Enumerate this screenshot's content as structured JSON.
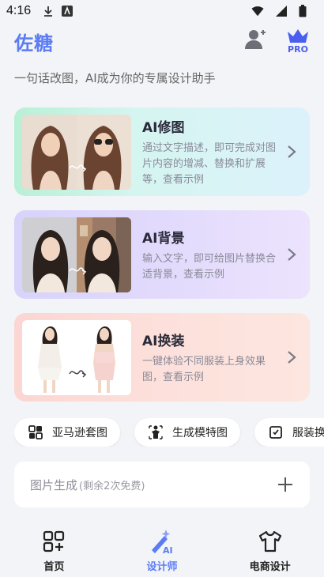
{
  "status_bar": {
    "time": "4:16"
  },
  "header": {
    "logo": "佐糖",
    "pro_label": "PRO"
  },
  "tagline": "一句话改图，AI成为你的专属设计助手",
  "cards": [
    {
      "title": "AI修图",
      "desc": "通过文字描述，即可完成对图片内容的增减、替换和扩展等，查看示例"
    },
    {
      "title": "AI背景",
      "desc": "输入文字，即可给图片替换合适背景，查看示例"
    },
    {
      "title": "AI换装",
      "desc": "一键体验不同服装上身效果图，查看示例"
    }
  ],
  "chips": [
    {
      "label": "亚马逊套图",
      "icon": "grid-layout-icon"
    },
    {
      "label": "生成模特图",
      "icon": "model-pose-icon"
    },
    {
      "label": "服装换",
      "icon": "clothing-tag-icon"
    }
  ],
  "generate": {
    "label": "图片生成",
    "sub": "(剩余2次免费)"
  },
  "nav": [
    {
      "label": "首页",
      "icon": "home-grid-icon"
    },
    {
      "label": "设计师",
      "icon": "ai-wand-icon",
      "active": true
    },
    {
      "label": "电商设计",
      "icon": "tshirt-icon"
    }
  ],
  "colors": {
    "brand": "#5b7cf4",
    "pro_crown": "#4a5ef0"
  }
}
